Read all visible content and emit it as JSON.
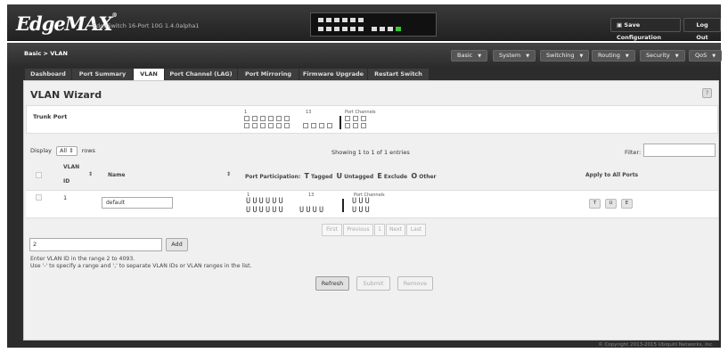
{
  "header": {
    "brand": "EdgeMAX",
    "brand_mark": "®",
    "model": "EdgeSwitch 16-Port 10G 1.4.0alpha1",
    "save_label": "Save Configuration",
    "save_icon": "floppy-icon",
    "logout_label": "Log Out"
  },
  "nav": {
    "breadcrumb": "Basic > VLAN",
    "menus": [
      "Basic",
      "System",
      "Switching",
      "Routing",
      "Security",
      "QoS"
    ]
  },
  "tabs": [
    "Dashboard",
    "Port Summary",
    "VLAN",
    "Port Channel (LAG)",
    "Port Mirroring",
    "Firmware Upgrade",
    "Restart Switch"
  ],
  "active_tab": "VLAN",
  "wizard": {
    "title": "VLAN Wizard",
    "help": "?",
    "trunk_label": "Trunk Port",
    "port_start": "1",
    "port_mid": "13",
    "port_channels": "Port Channels"
  },
  "table_controls": {
    "display_label": "Display",
    "display_value": "All",
    "rows_label": "rows",
    "showing": "Showing 1 to 1 of 1 entries",
    "filter_label": "Filter:",
    "filter_value": ""
  },
  "columns": {
    "vlan": "VLAN",
    "id": "ID",
    "name": "Name",
    "participation": "Port Participation:",
    "legend": [
      {
        "sym": "T",
        "label": "Tagged"
      },
      {
        "sym": "U",
        "label": "Untagged"
      },
      {
        "sym": "E",
        "label": "Exclude"
      },
      {
        "sym": "O",
        "label": "Other"
      }
    ],
    "apply_all": "Apply to All Ports"
  },
  "rows": [
    {
      "id": "1",
      "name": "default",
      "port_start": "1",
      "port_mid": "13",
      "port_channels": "Port Channels",
      "line1": "UUUUUU",
      "line2a": "UUUUUU",
      "line2b": "UUUU",
      "pc1": "UUU",
      "pc2": "UUU",
      "apply_buttons": [
        "T",
        "U",
        "E"
      ]
    }
  ],
  "pager": [
    "First",
    "Previous",
    "1",
    "Next",
    "Last"
  ],
  "add": {
    "value": "2",
    "button": "Add",
    "hint1": "Enter VLAN ID in the range 2 to 4093.",
    "hint2": "Use '-' to specify a range and ',' to separate VLAN IDs or VLAN ranges in the list."
  },
  "actions": {
    "refresh": "Refresh",
    "submit": "Submit",
    "remove": "Remove"
  },
  "footer": {
    "copyright": "© Copyright 2013-2015 Ubiquiti Networks, Inc."
  }
}
